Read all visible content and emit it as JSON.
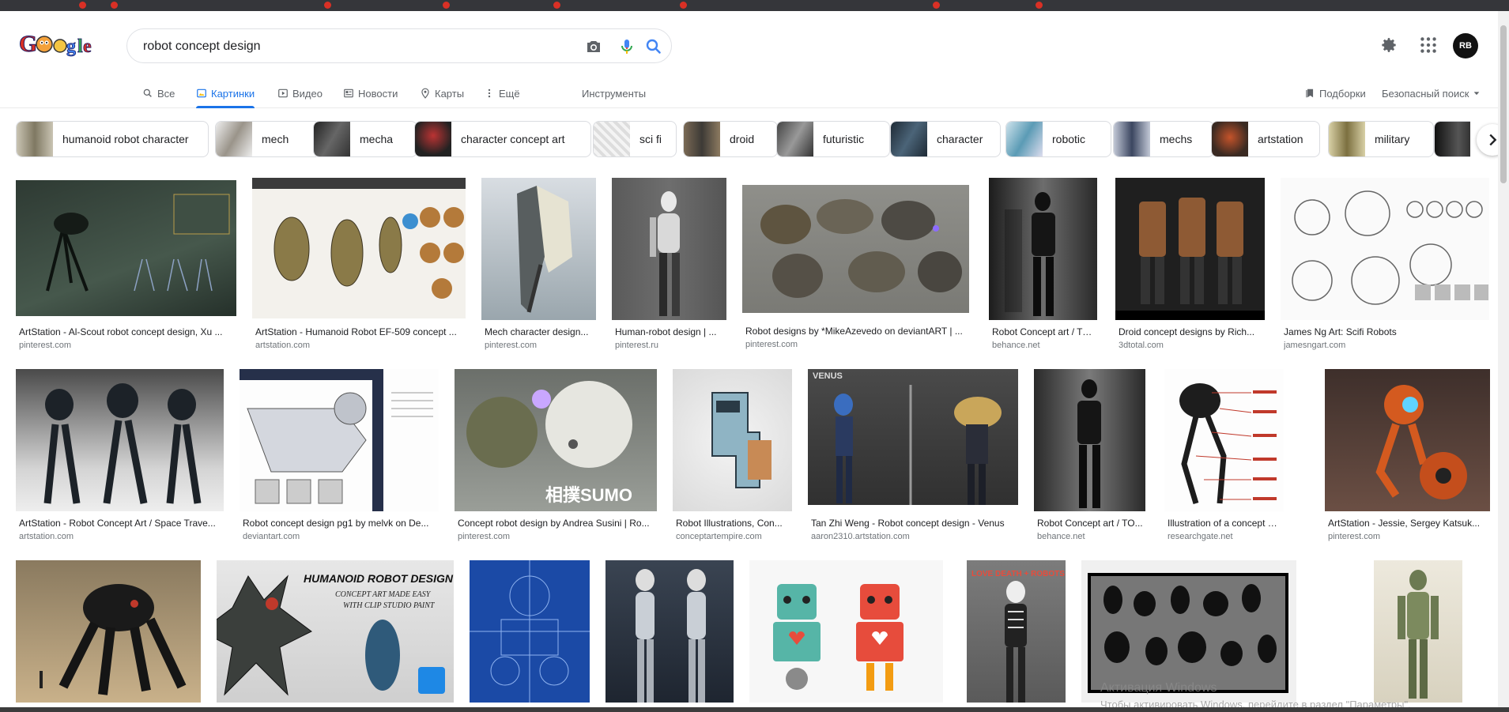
{
  "search": {
    "query": "robot concept design"
  },
  "avatar_text": "RB",
  "tabs": [
    {
      "label": "Все",
      "icon": "search-icon"
    },
    {
      "label": "Картинки",
      "icon": "image-icon",
      "active": true
    },
    {
      "label": "Видео",
      "icon": "video-icon"
    },
    {
      "label": "Новости",
      "icon": "news-icon"
    },
    {
      "label": "Карты",
      "icon": "map-pin-icon"
    },
    {
      "label": "Ещё",
      "icon": "more-vert-icon"
    },
    {
      "label": "Инструменты"
    }
  ],
  "right_tools": {
    "collections": "Подборки",
    "safe_search": "Безопасный поиск"
  },
  "chips": [
    "humanoid robot character",
    "mech",
    "mecha",
    "character concept art",
    "sci fi",
    "droid",
    "futuristic",
    "character",
    "robotic",
    "mechs",
    "artstation",
    "military"
  ],
  "results": [
    {
      "caption": "ArtStation - Al-Scout robot concept design, Xu ...",
      "source": "pinterest.com"
    },
    {
      "caption": "ArtStation - Humanoid Robot EF-509 concept ...",
      "source": "artstation.com"
    },
    {
      "caption": "Mech character design...",
      "source": "pinterest.com"
    },
    {
      "caption": "Human-robot design | ...",
      "source": "pinterest.ru"
    },
    {
      "caption": "Robot designs by *MikeAzevedo on deviantART | ...",
      "source": "pinterest.com"
    },
    {
      "caption": "Robot Concept art / TO...",
      "source": "behance.net"
    },
    {
      "caption": "Droid concept designs by Rich...",
      "source": "3dtotal.com"
    },
    {
      "caption": "James Ng Art: Scifi Robots",
      "source": "jamesngart.com"
    },
    {
      "caption": "ArtStation - Robot Concept Art / Space Trave...",
      "source": "artstation.com"
    },
    {
      "caption": "Robot concept design pg1 by melvk on De...",
      "source": "deviantart.com"
    },
    {
      "caption": "Concept robot design by Andrea Susini | Ro...",
      "source": "pinterest.com"
    },
    {
      "caption": "Robot Illustrations, Con...",
      "source": "conceptartempire.com"
    },
    {
      "caption": "Tan Zhi Weng - Robot concept design - Venus",
      "source": "aaron2310.artstation.com"
    },
    {
      "caption": "Robot Concept art / TO...",
      "source": "behance.net"
    },
    {
      "caption": "Illustration of a concept desig...",
      "source": "researchgate.net"
    },
    {
      "caption": "ArtStation - Jessie, Sergey Katsuk...",
      "source": "pinterest.com"
    }
  ],
  "image_text": {
    "humanoid_title": "HUMANOID ROBOT DESIGN",
    "humanoid_sub1": "CONCEPT ART MADE EASY",
    "humanoid_sub2": "WITH CLIP STUDIO PAINT",
    "sumo": "相撲SUMO",
    "venus": "VENUS",
    "love_death": "LOVE DEATH + ROBOTS"
  },
  "watermark": {
    "title": "Активация Windows",
    "text": "Чтобы активировать Windows, перейдите в раздел \"Параметры\"."
  },
  "colors": {
    "accent": "#1a73e8",
    "muted": "#5f6368",
    "border": "#dadce0"
  }
}
